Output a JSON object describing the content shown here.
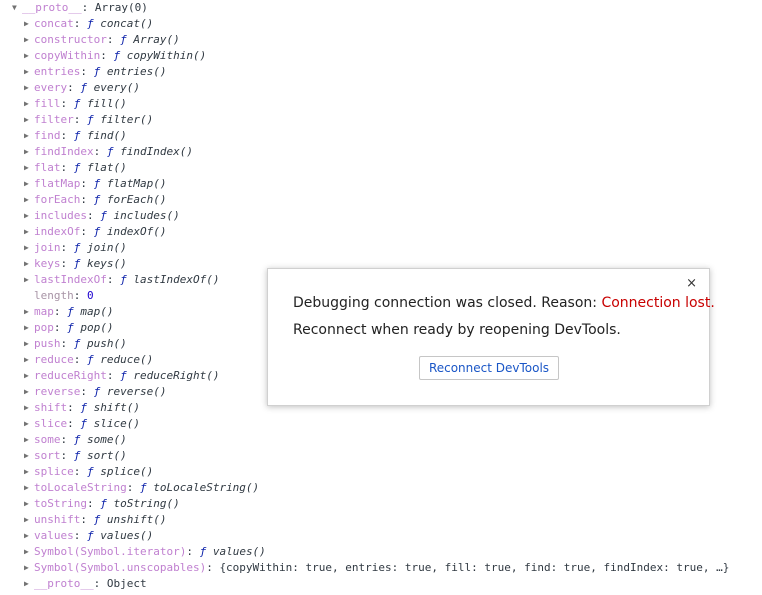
{
  "console": {
    "root": {
      "arrow": "▼",
      "key": "__proto__",
      "value": "Array(0)"
    },
    "rows": [
      {
        "key": "concat",
        "sep": ": ",
        "f": "ƒ",
        "value": " concat()",
        "style": "fn"
      },
      {
        "key": "constructor",
        "sep": ": ",
        "f": "ƒ",
        "value": " Array()",
        "style": "fn"
      },
      {
        "key": "copyWithin",
        "sep": ": ",
        "f": "ƒ",
        "value": " copyWithin()",
        "style": "fn"
      },
      {
        "key": "entries",
        "sep": ": ",
        "f": "ƒ",
        "value": " entries()",
        "style": "fn"
      },
      {
        "key": "every",
        "sep": ": ",
        "f": "ƒ",
        "value": " every()",
        "style": "fn"
      },
      {
        "key": "fill",
        "sep": ": ",
        "f": "ƒ",
        "value": " fill()",
        "style": "fn"
      },
      {
        "key": "filter",
        "sep": ": ",
        "f": "ƒ",
        "value": " filter()",
        "style": "fn"
      },
      {
        "key": "find",
        "sep": ": ",
        "f": "ƒ",
        "value": " find()",
        "style": "fn"
      },
      {
        "key": "findIndex",
        "sep": ": ",
        "f": "ƒ",
        "value": " findIndex()",
        "style": "fn"
      },
      {
        "key": "flat",
        "sep": ": ",
        "f": "ƒ",
        "value": " flat()",
        "style": "fn"
      },
      {
        "key": "flatMap",
        "sep": ": ",
        "f": "ƒ",
        "value": " flatMap()",
        "style": "fn"
      },
      {
        "key": "forEach",
        "sep": ": ",
        "f": "ƒ",
        "value": " forEach()",
        "style": "fn"
      },
      {
        "key": "includes",
        "sep": ": ",
        "f": "ƒ",
        "value": " includes()",
        "style": "fn"
      },
      {
        "key": "indexOf",
        "sep": ": ",
        "f": "ƒ",
        "value": " indexOf()",
        "style": "fn"
      },
      {
        "key": "join",
        "sep": ": ",
        "f": "ƒ",
        "value": " join()",
        "style": "fn"
      },
      {
        "key": "keys",
        "sep": ": ",
        "f": "ƒ",
        "value": " keys()",
        "style": "fn"
      },
      {
        "key": "lastIndexOf",
        "sep": ": ",
        "f": "ƒ",
        "value": " lastIndexOf()",
        "style": "fn"
      },
      {
        "key": "length",
        "sep": ": ",
        "f": "",
        "value": "0",
        "style": "num"
      },
      {
        "key": "map",
        "sep": ": ",
        "f": "ƒ",
        "value": " map()",
        "style": "fn"
      },
      {
        "key": "pop",
        "sep": ": ",
        "f": "ƒ",
        "value": " pop()",
        "style": "fn"
      },
      {
        "key": "push",
        "sep": ": ",
        "f": "ƒ",
        "value": " push()",
        "style": "fn"
      },
      {
        "key": "reduce",
        "sep": ": ",
        "f": "ƒ",
        "value": " reduce()",
        "style": "fn"
      },
      {
        "key": "reduceRight",
        "sep": ": ",
        "f": "ƒ",
        "value": " reduceRight()",
        "style": "fn"
      },
      {
        "key": "reverse",
        "sep": ": ",
        "f": "ƒ",
        "value": " reverse()",
        "style": "fn"
      },
      {
        "key": "shift",
        "sep": ": ",
        "f": "ƒ",
        "value": " shift()",
        "style": "fn"
      },
      {
        "key": "slice",
        "sep": ": ",
        "f": "ƒ",
        "value": " slice()",
        "style": "fn"
      },
      {
        "key": "some",
        "sep": ": ",
        "f": "ƒ",
        "value": " some()",
        "style": "fn"
      },
      {
        "key": "sort",
        "sep": ": ",
        "f": "ƒ",
        "value": " sort()",
        "style": "fn"
      },
      {
        "key": "splice",
        "sep": ": ",
        "f": "ƒ",
        "value": " splice()",
        "style": "fn"
      },
      {
        "key": "toLocaleString",
        "sep": ": ",
        "f": "ƒ",
        "value": " toLocaleString()",
        "style": "fn"
      },
      {
        "key": "toString",
        "sep": ": ",
        "f": "ƒ",
        "value": " toString()",
        "style": "fn"
      },
      {
        "key": "unshift",
        "sep": ": ",
        "f": "ƒ",
        "value": " unshift()",
        "style": "fn"
      },
      {
        "key": "values",
        "sep": ": ",
        "f": "ƒ",
        "value": " values()",
        "style": "fn"
      },
      {
        "key": "Symbol(Symbol.iterator)",
        "sep": ": ",
        "f": "ƒ",
        "value": " values()",
        "style": "fn"
      },
      {
        "key": "Symbol(Symbol.unscopables)",
        "sep": ": ",
        "f": "",
        "value": "{copyWithin: true, entries: true, fill: true, find: true, findIndex: true, …}",
        "style": "obj"
      },
      {
        "key": "__proto__",
        "sep": ": ",
        "f": "",
        "value": "Object",
        "style": "obj"
      }
    ],
    "expand_arrow": "▶"
  },
  "dialog": {
    "close_label": "×",
    "message_prefix": "Debugging connection was closed. Reason: ",
    "message_reason": "Connection lost.",
    "message_line2": "Reconnect when ready by reopening DevTools.",
    "reconnect_label": "Reconnect DevTools"
  },
  "colors": {
    "reason": "#c80000",
    "button_text": "#1a56c6",
    "key": "#c080d0",
    "function_f": "#0d22aa"
  }
}
